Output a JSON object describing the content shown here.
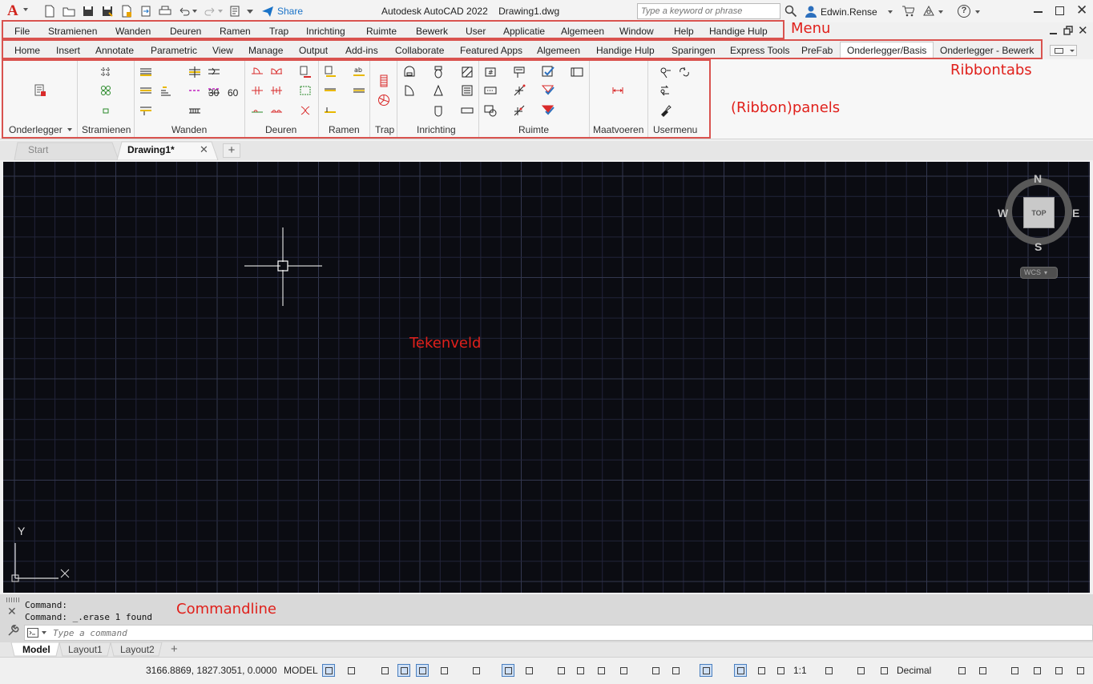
{
  "title_bar": {
    "app_title": "Autodesk AutoCAD 2022",
    "drawing_name": "Drawing1.dwg",
    "share_label": "Share",
    "search_placeholder": "Type a keyword or phrase",
    "user_name": "Edwin.Rense"
  },
  "menu": {
    "items": [
      "File",
      "Stramienen",
      "Wanden",
      "Deuren",
      "Ramen",
      "Trap",
      "Inrichting",
      "Ruimte",
      "Bewerk",
      "User",
      "Applicatie",
      "Algemeen",
      "Window",
      "Help",
      "Handige Hulp"
    ]
  },
  "ribbon_tabs": {
    "items": [
      "Home",
      "Insert",
      "Annotate",
      "Parametric",
      "View",
      "Manage",
      "Output",
      "Add-ins",
      "Collaborate",
      "Featured Apps",
      "Algemeen",
      "Handige Hulp",
      "Sparingen",
      "Express Tools",
      "PreFab",
      "Onderlegger/Basis",
      "Onderlegger - Bewerk"
    ],
    "active": "Onderlegger/Basis"
  },
  "panels": {
    "labels": [
      "Onderlegger",
      "Stramienen",
      "Wanden",
      "Deuren",
      "Ramen",
      "Trap",
      "Inrichting",
      "Ruimte",
      "Maatvoeren",
      "Usermenu"
    ],
    "numbers": [
      "30",
      "60"
    ]
  },
  "annotations": {
    "menu": "Menu",
    "ribbontabs": "Ribbontabs",
    "panels": "(Ribbon)panels",
    "canvas": "Tekenveld",
    "commandline": "Commandline"
  },
  "doc_tabs": {
    "start": "Start",
    "drawing": "Drawing1*"
  },
  "viewcube": {
    "north": "N",
    "south": "S",
    "east": "E",
    "west": "W",
    "face": "TOP",
    "wcs": "WCS"
  },
  "ucs": {
    "x": "X",
    "y": "Y"
  },
  "command": {
    "history": [
      "Command:",
      "Command: _.erase 1 found"
    ],
    "placeholder": "Type a command"
  },
  "layout_tabs": [
    "Model",
    "Layout1",
    "Layout2"
  ],
  "status_bar": {
    "coordinates": "3166.8869, 1827.3051, 0.0000",
    "space": "MODEL",
    "scale": "1:1",
    "units": "Decimal"
  },
  "colors": {
    "accent_red": "#e0201b",
    "canvas_bg": "#0b0c12",
    "grid_minor": "#22243a",
    "grid_major": "#33374f"
  }
}
